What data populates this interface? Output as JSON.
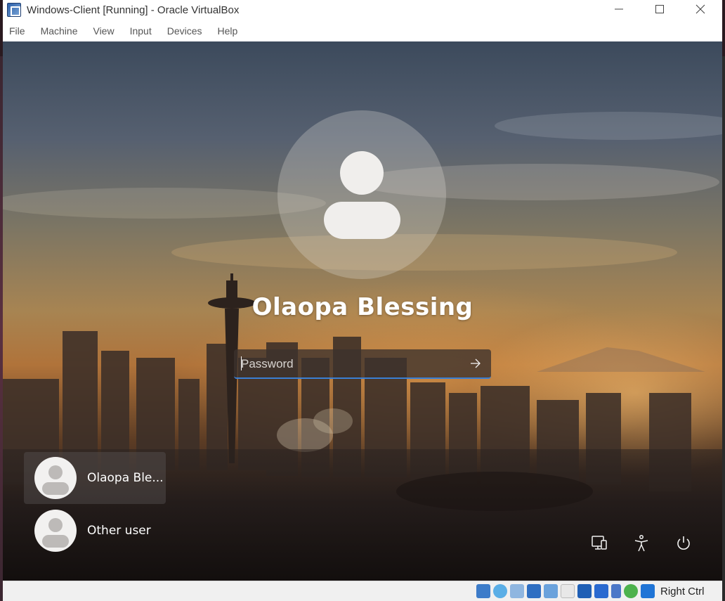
{
  "window": {
    "title": "Windows-Client [Running] - Oracle VirtualBox",
    "controls": [
      "minimize",
      "maximize",
      "close"
    ]
  },
  "menubar": {
    "items": [
      "File",
      "Machine",
      "View",
      "Input",
      "Devices",
      "Help"
    ]
  },
  "login": {
    "user_name": "Olaopa Blessing",
    "password_placeholder": "Password",
    "submit_icon": "arrow-right-icon"
  },
  "user_tiles": [
    {
      "label": "Olaopa Ble...",
      "selected": true
    },
    {
      "label": "Other user",
      "selected": false
    }
  ],
  "corner_icons": [
    "network-icon",
    "accessibility-icon",
    "power-icon"
  ],
  "statusbar": {
    "icons": [
      "hard-disk-icon",
      "optical-drive-icon",
      "audio-icon",
      "network-adapters-icon",
      "usb-icon",
      "shared-folders-icon",
      "display-icon",
      "video-capture-icon",
      "virtualization-icon",
      "guest-additions-icon",
      "keyboard-capture-icon"
    ],
    "host_key": "Right Ctrl"
  },
  "colors": {
    "accent": "#3a7fd4",
    "titlebar_bg": "#ffffff",
    "statusbar_bg": "#f0f0f0"
  }
}
